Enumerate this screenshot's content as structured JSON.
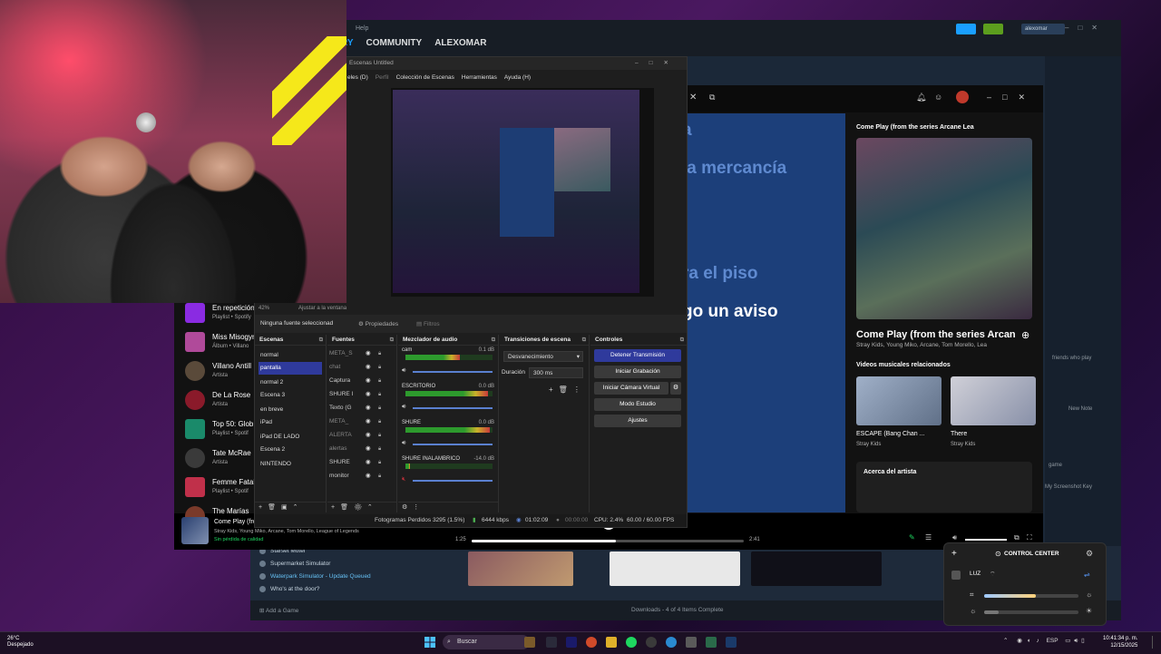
{
  "steam": {
    "help": "Help",
    "nav": [
      "RY",
      "COMMUNITY",
      "ALEXOMAR"
    ],
    "user": "alexomar",
    "library": [
      "Starset Motel",
      "Supermarket Simulator",
      "Waterpark Simulator - Update Queued",
      "Who's at the door?"
    ],
    "add_game": "Add a Game",
    "downloads": "Downloads - 4 of 4 Items Complete",
    "side_texts": [
      "friends who play",
      "New Note",
      "game",
      "My Screenshot Key"
    ]
  },
  "spotify": {
    "blue_lines": [
      "a",
      "la mercancía",
      "ra el piso",
      "go un aviso"
    ],
    "now_playing_header": "Come Play (from the series Arcane Lea",
    "now_playing_title": "Come Play (from the series Arcan",
    "now_playing_artists": "Stray Kids, Young Miko, Arcane, Tom Morello, Lea",
    "related_label": "Videos musicales relacionados",
    "videos": [
      {
        "title": "ESCAPE (Bang Chan ...",
        "artist": "Stray Kids"
      },
      {
        "title": "There",
        "artist": "Stray Kids"
      }
    ],
    "about_artist": "Acerca del artista",
    "library": [
      {
        "title": "En repetición",
        "sub": "Playlist • Spotify"
      },
      {
        "title": "Miss Misogyn",
        "sub": "Álbum • Villano"
      },
      {
        "title": "Villano Antill",
        "sub": "Artista"
      },
      {
        "title": "De La Rose",
        "sub": "Artista"
      },
      {
        "title": "Top 50: Glob",
        "sub": "Playlist • Spotif"
      },
      {
        "title": "Tate McRae",
        "sub": "Artista"
      },
      {
        "title": "Femme Fatal",
        "sub": "Playlist • Spotif"
      },
      {
        "title": "The Marías",
        "sub": ""
      }
    ],
    "player_title": "Come Play (from the series Arcane League of Legends)",
    "player_artists": "Stray Kids, Young Miko, Arcane, Tom Morello, League of Legends",
    "player_quality": "Sin pérdida de calidad",
    "time_elapsed": "1:25",
    "time_total": "2:41",
    "progress": 0.53
  },
  "obs": {
    "title": "Escenas Untitled",
    "menu": [
      "eles (D)",
      "Perfil",
      "Colección de Escenas",
      "Herramientas",
      "Ayuda (H)"
    ],
    "zoom": "42%",
    "zoom_mode": "Ajustar a la ventana",
    "no_source": "Ninguna fuente seleccionad",
    "properties": "Propiedades",
    "filters": "Filtros",
    "docks": {
      "scenes": "Escenas",
      "sources": "Fuentes",
      "mixer": "Mezclador de audio",
      "transitions": "Transiciones de escena",
      "controls": "Controles"
    },
    "scenes": [
      "normal",
      "pantalla",
      "normal 2",
      "Escena 3",
      "en breve",
      "iPad",
      "iPad DE LADO",
      "Escena 2",
      "NINTENDO"
    ],
    "sources": [
      "META_S",
      "chat",
      "Captura",
      "SHURE I",
      "Texto (G",
      "META_",
      "ALERTA",
      "alertas",
      "SHURE",
      "monitor"
    ],
    "mixer": [
      {
        "name": "cam",
        "db": "0.1 dB",
        "level": 0.62
      },
      {
        "name": "ESCRITORIO",
        "db": "0.0 dB",
        "level": 0.95
      },
      {
        "name": "SHURE",
        "db": "0.0 dB",
        "level": 0.97
      },
      {
        "name": "SHURE INALAMBRICO",
        "db": "-14.0 dB",
        "level": 0.05
      }
    ],
    "transition": "Desvanecimiento",
    "duration_label": "Duración",
    "duration": "300 ms",
    "controls": [
      "Detener Transmisión",
      "Iniciar Grabación",
      "Iniciar Cámara Virtual",
      "Modo Estudio",
      "Ajustes"
    ],
    "status": {
      "dropped": "Fotogramas Perdidos 3295 (1.5%)",
      "bitrate": "6444 kbps",
      "stream_time": "01:02:09",
      "rec_time": "00:00:00",
      "cpu": "CPU: 2.4%",
      "fps": "60.00 / 60.00 FPS"
    }
  },
  "control_center": {
    "title": "CONTROL CENTER",
    "luz": "LUZ",
    "slider1": 0.55,
    "slider2": 0.15
  },
  "taskbar": {
    "temp": "26°C",
    "weather": "Despejado",
    "search": "Buscar",
    "lang": "ESP",
    "time": "10:41:34 p. m.",
    "date": "12/15/2025"
  }
}
